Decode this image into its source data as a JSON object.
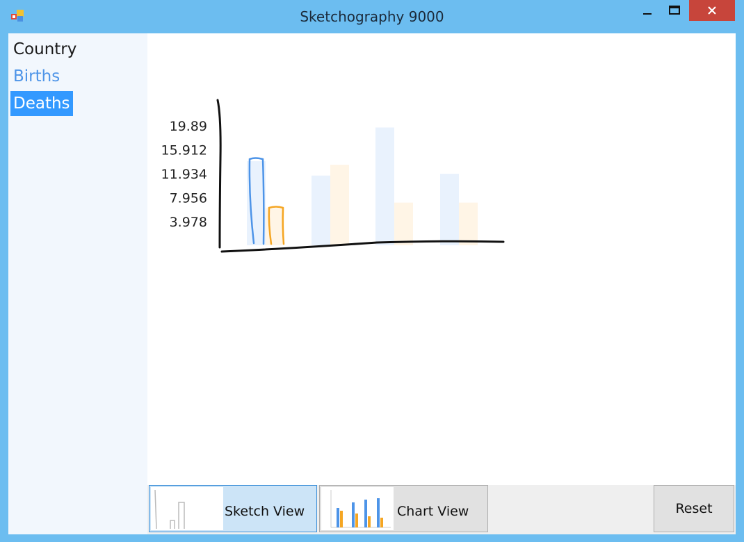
{
  "window": {
    "title": "Sketchography 9000"
  },
  "sidebar": {
    "items": [
      {
        "label": "Country",
        "color": "#1a1a1a",
        "selected": false
      },
      {
        "label": "Births",
        "color": "#4d94e8",
        "selected": false
      },
      {
        "label": "Deaths",
        "color": "#ffffff",
        "selected": true,
        "highlight": "#3399ff"
      }
    ]
  },
  "chart_data": {
    "type": "bar",
    "y_ticks": [
      "19.89",
      "15.912",
      "11.934",
      "7.956",
      "3.978"
    ],
    "series": [
      {
        "values": [
          14.0,
          11.6,
          19.6,
          11.9
        ],
        "color": "#4d94e8"
      },
      {
        "values": [
          6.2,
          13.4,
          7.1,
          7.1
        ],
        "color": "#f5a623"
      }
    ],
    "ylim": [
      0,
      19.89
    ],
    "sketched_index": 0
  },
  "toolbar": {
    "sketch_label": "Sketch View",
    "chart_label": "Chart View",
    "reset_label": "Reset"
  }
}
